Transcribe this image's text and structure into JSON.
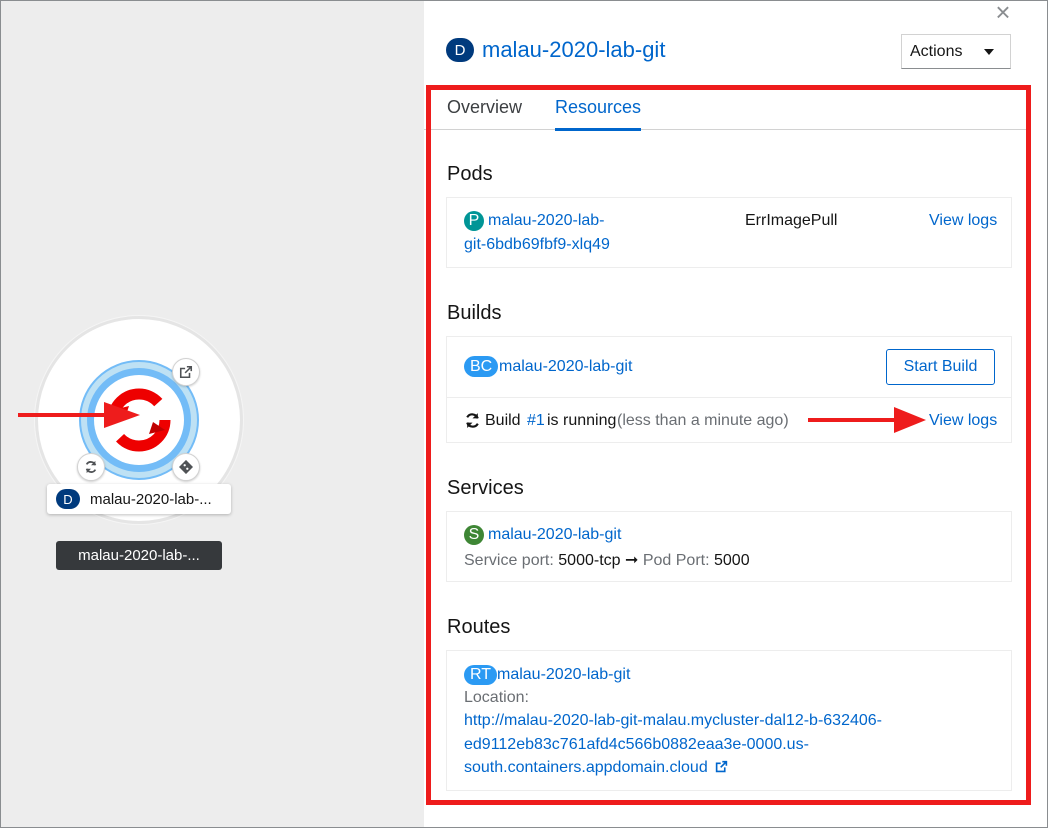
{
  "canvas": {
    "node_label": "malau-2020-lab-...",
    "node_badge": "D",
    "tooltip": "malau-2020-lab-..."
  },
  "panel": {
    "close_label": "×",
    "badge": "D",
    "title": "malau-2020-lab-git",
    "actions_label": "Actions",
    "tabs": [
      {
        "label": "Overview"
      },
      {
        "label": "Resources"
      }
    ],
    "pods": {
      "heading": "Pods",
      "badge": "P",
      "name_line1": "malau-2020-lab-",
      "name_line2": "git-6bdb69fbf9-xlq49",
      "status": "ErrImagePull",
      "view_logs": "View logs"
    },
    "builds": {
      "heading": "Builds",
      "badge": "BC",
      "name": "malau-2020-lab-git",
      "start_build": "Start Build",
      "build_prefix": "Build",
      "build_number": "#1",
      "build_status": "is running",
      "build_time": "(less than a minute ago)",
      "view_logs": "View logs"
    },
    "services": {
      "heading": "Services",
      "badge": "S",
      "name": "malau-2020-lab-git",
      "service_port_label": "Service port:",
      "service_port": "5000-tcp",
      "arrow": "➞",
      "pod_port_label": "Pod Port:",
      "pod_port": "5000"
    },
    "routes": {
      "heading": "Routes",
      "badge": "RT",
      "name": "malau-2020-lab-git",
      "location_label": "Location:",
      "url_line1": "http://malau-2020-lab-git-malau.mycluster-dal12-b-632406-",
      "url_line2": "ed9112eb83c761afd4c566b0882eaa3e-0000.us-",
      "url_line3": "south.containers.appdomain.cloud"
    }
  },
  "icons": {
    "external_link": "external-link-icon",
    "sync": "sync-icon",
    "git": "git-icon",
    "close": "close-icon"
  },
  "colors": {
    "link": "#0066cc",
    "annotation_red": "#ee1c1c",
    "ring_blue": "#73bcf7",
    "openshift_red": "#ee0000"
  }
}
